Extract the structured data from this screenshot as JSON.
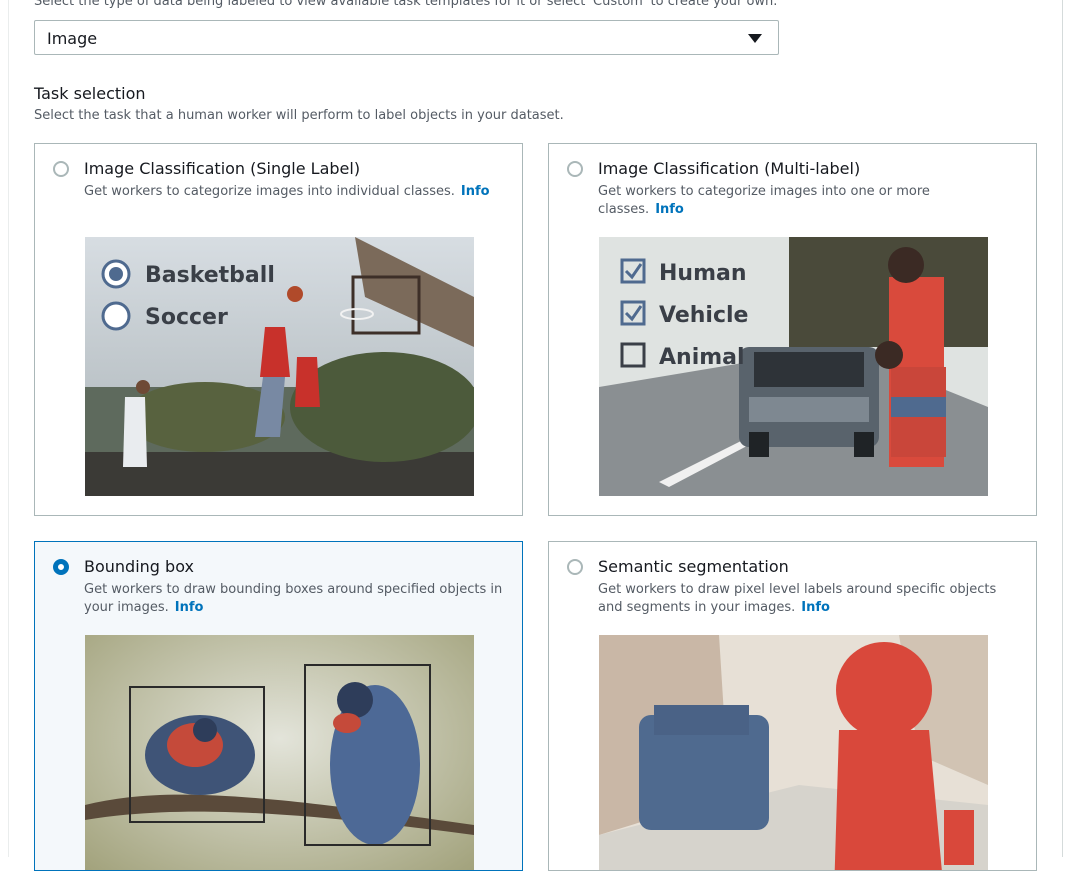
{
  "data_type": {
    "description": "Select the type of data being labeled to view available task templates for it or select 'Custom' to create your own.",
    "selected": "Image"
  },
  "task_selection": {
    "title": "Task selection",
    "description": "Select the task that a human worker will perform to label objects in your dataset.",
    "info_label": "Info",
    "cards": [
      {
        "title": "Image Classification (Single Label)",
        "description": "Get workers to categorize images into individual classes.",
        "selected": false,
        "thumbnail": {
          "options": [
            "Basketball",
            "Soccer"
          ],
          "checked": [
            true,
            false
          ]
        }
      },
      {
        "title": "Image Classification (Multi-label)",
        "description": "Get workers to categorize images into one or more classes.",
        "selected": false,
        "thumbnail": {
          "options": [
            "Human",
            "Vehicle",
            "Animal"
          ],
          "checked": [
            true,
            true,
            false
          ]
        }
      },
      {
        "title": "Bounding box",
        "description": "Get workers to draw bounding boxes around specified objects in your images.",
        "selected": true
      },
      {
        "title": "Semantic segmentation",
        "description": "Get workers to draw pixel level labels around specific objects and segments in your images.",
        "selected": false
      }
    ]
  },
  "colors": {
    "accent": "#0073bb",
    "border": "#aab7b8",
    "muted_text": "#545b64",
    "seg_red": "#d9483b",
    "seg_blue": "#4f6a8f"
  }
}
